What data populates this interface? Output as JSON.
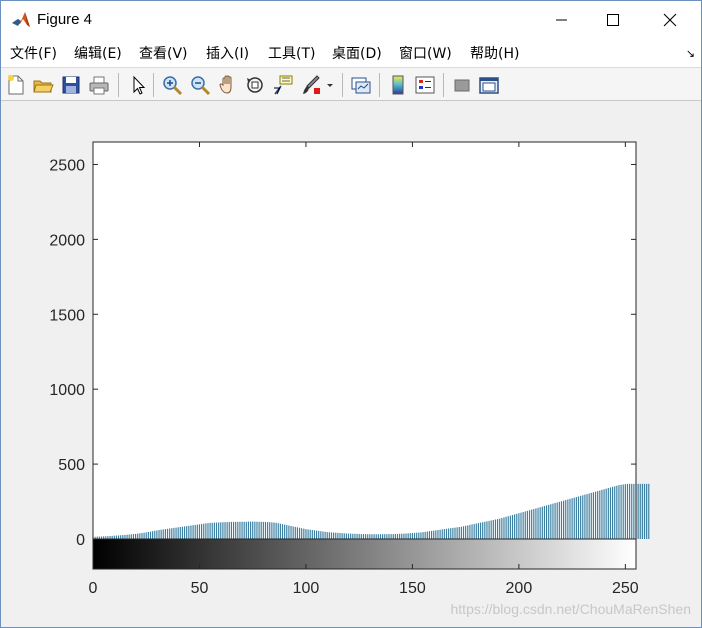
{
  "window": {
    "title": "Figure 4",
    "icon": "matlab-icon"
  },
  "menu": {
    "items": [
      "文件(F)",
      "编辑(E)",
      "查看(V)",
      "插入(I)",
      "工具(T)",
      "桌面(D)",
      "窗口(W)",
      "帮助(H)"
    ],
    "overflow_icon": "dock-arrow-icon"
  },
  "toolbar": {
    "buttons": [
      "new-figure-icon",
      "open-file-icon",
      "save-icon",
      "print-icon",
      "edit-plot-arrow-icon",
      "zoom-in-icon",
      "zoom-out-icon",
      "pan-hand-icon",
      "rotate-3d-icon",
      "data-cursor-icon",
      "brush-icon",
      "brush-dropdown-icon",
      "link-plot-icon",
      "insert-colorbar-icon",
      "insert-legend-icon",
      "hide-plot-tools-icon",
      "show-plot-tools-icon"
    ]
  },
  "chart_data": {
    "type": "bar",
    "title": "",
    "xlabel": "",
    "ylabel": "",
    "xlim": [
      0,
      255
    ],
    "ylim": [
      0,
      2650
    ],
    "yticks": [
      0,
      500,
      1000,
      1500,
      2000,
      2500
    ],
    "xticks": [
      0,
      50,
      100,
      150,
      200,
      250
    ],
    "bar_color": "#3a7ea0",
    "colorbar": "grayscale 0-255 beneath axis",
    "series_description": "256-bin grayscale intensity histogram",
    "values": [
      15,
      15,
      16,
      16,
      17,
      18,
      18,
      19,
      20,
      21,
      22,
      23,
      24,
      25,
      26,
      27,
      29,
      30,
      31,
      33,
      34,
      36,
      38,
      40,
      42,
      44,
      47,
      49,
      52,
      55,
      57,
      60,
      62,
      64,
      66,
      68,
      70,
      72,
      74,
      76,
      78,
      80,
      82,
      84,
      86,
      88,
      90,
      92,
      94,
      96,
      98,
      100,
      102,
      104,
      106,
      108,
      108,
      109,
      110,
      110,
      111,
      112,
      112,
      113,
      113,
      114,
      114,
      114,
      115,
      115,
      115,
      115,
      115,
      116,
      116,
      116,
      116,
      115,
      115,
      115,
      114,
      114,
      113,
      112,
      111,
      110,
      108,
      105,
      102,
      99,
      96,
      93,
      90,
      87,
      84,
      81,
      78,
      75,
      72,
      69,
      66,
      64,
      62,
      60,
      58,
      56,
      54,
      52,
      50,
      48,
      46,
      45,
      44,
      43,
      42,
      41,
      40,
      39,
      38,
      37,
      36,
      36,
      35,
      35,
      34,
      34,
      33,
      33,
      33,
      32,
      32,
      32,
      32,
      32,
      32,
      32,
      32,
      32,
      32,
      33,
      33,
      33,
      34,
      34,
      35,
      35,
      36,
      37,
      38,
      39,
      40,
      41,
      42,
      43,
      44,
      46,
      48,
      50,
      52,
      54,
      56,
      58,
      60,
      62,
      64,
      66,
      68,
      70,
      72,
      74,
      76,
      78,
      80,
      82,
      85,
      88,
      91,
      94,
      97,
      100,
      103,
      106,
      109,
      112,
      115,
      118,
      121,
      124,
      127,
      130,
      133,
      136,
      140,
      144,
      148,
      152,
      156,
      160,
      164,
      168,
      172,
      176,
      180,
      184,
      188,
      192,
      196,
      200,
      204,
      208,
      212,
      216,
      220,
      224,
      228,
      232,
      236,
      240,
      244,
      248,
      252,
      256,
      260,
      264,
      268,
      272,
      276,
      280,
      284,
      288,
      292,
      296,
      300,
      304,
      308,
      312,
      316,
      320,
      324,
      328,
      332,
      336,
      340,
      344,
      348,
      352,
      356,
      360,
      362,
      364,
      366,
      368,
      368,
      368,
      368,
      368,
      368,
      368,
      368,
      368,
      368,
      368
    ]
  },
  "watermark": "https://blog.csdn.net/ChouMaRenShen"
}
